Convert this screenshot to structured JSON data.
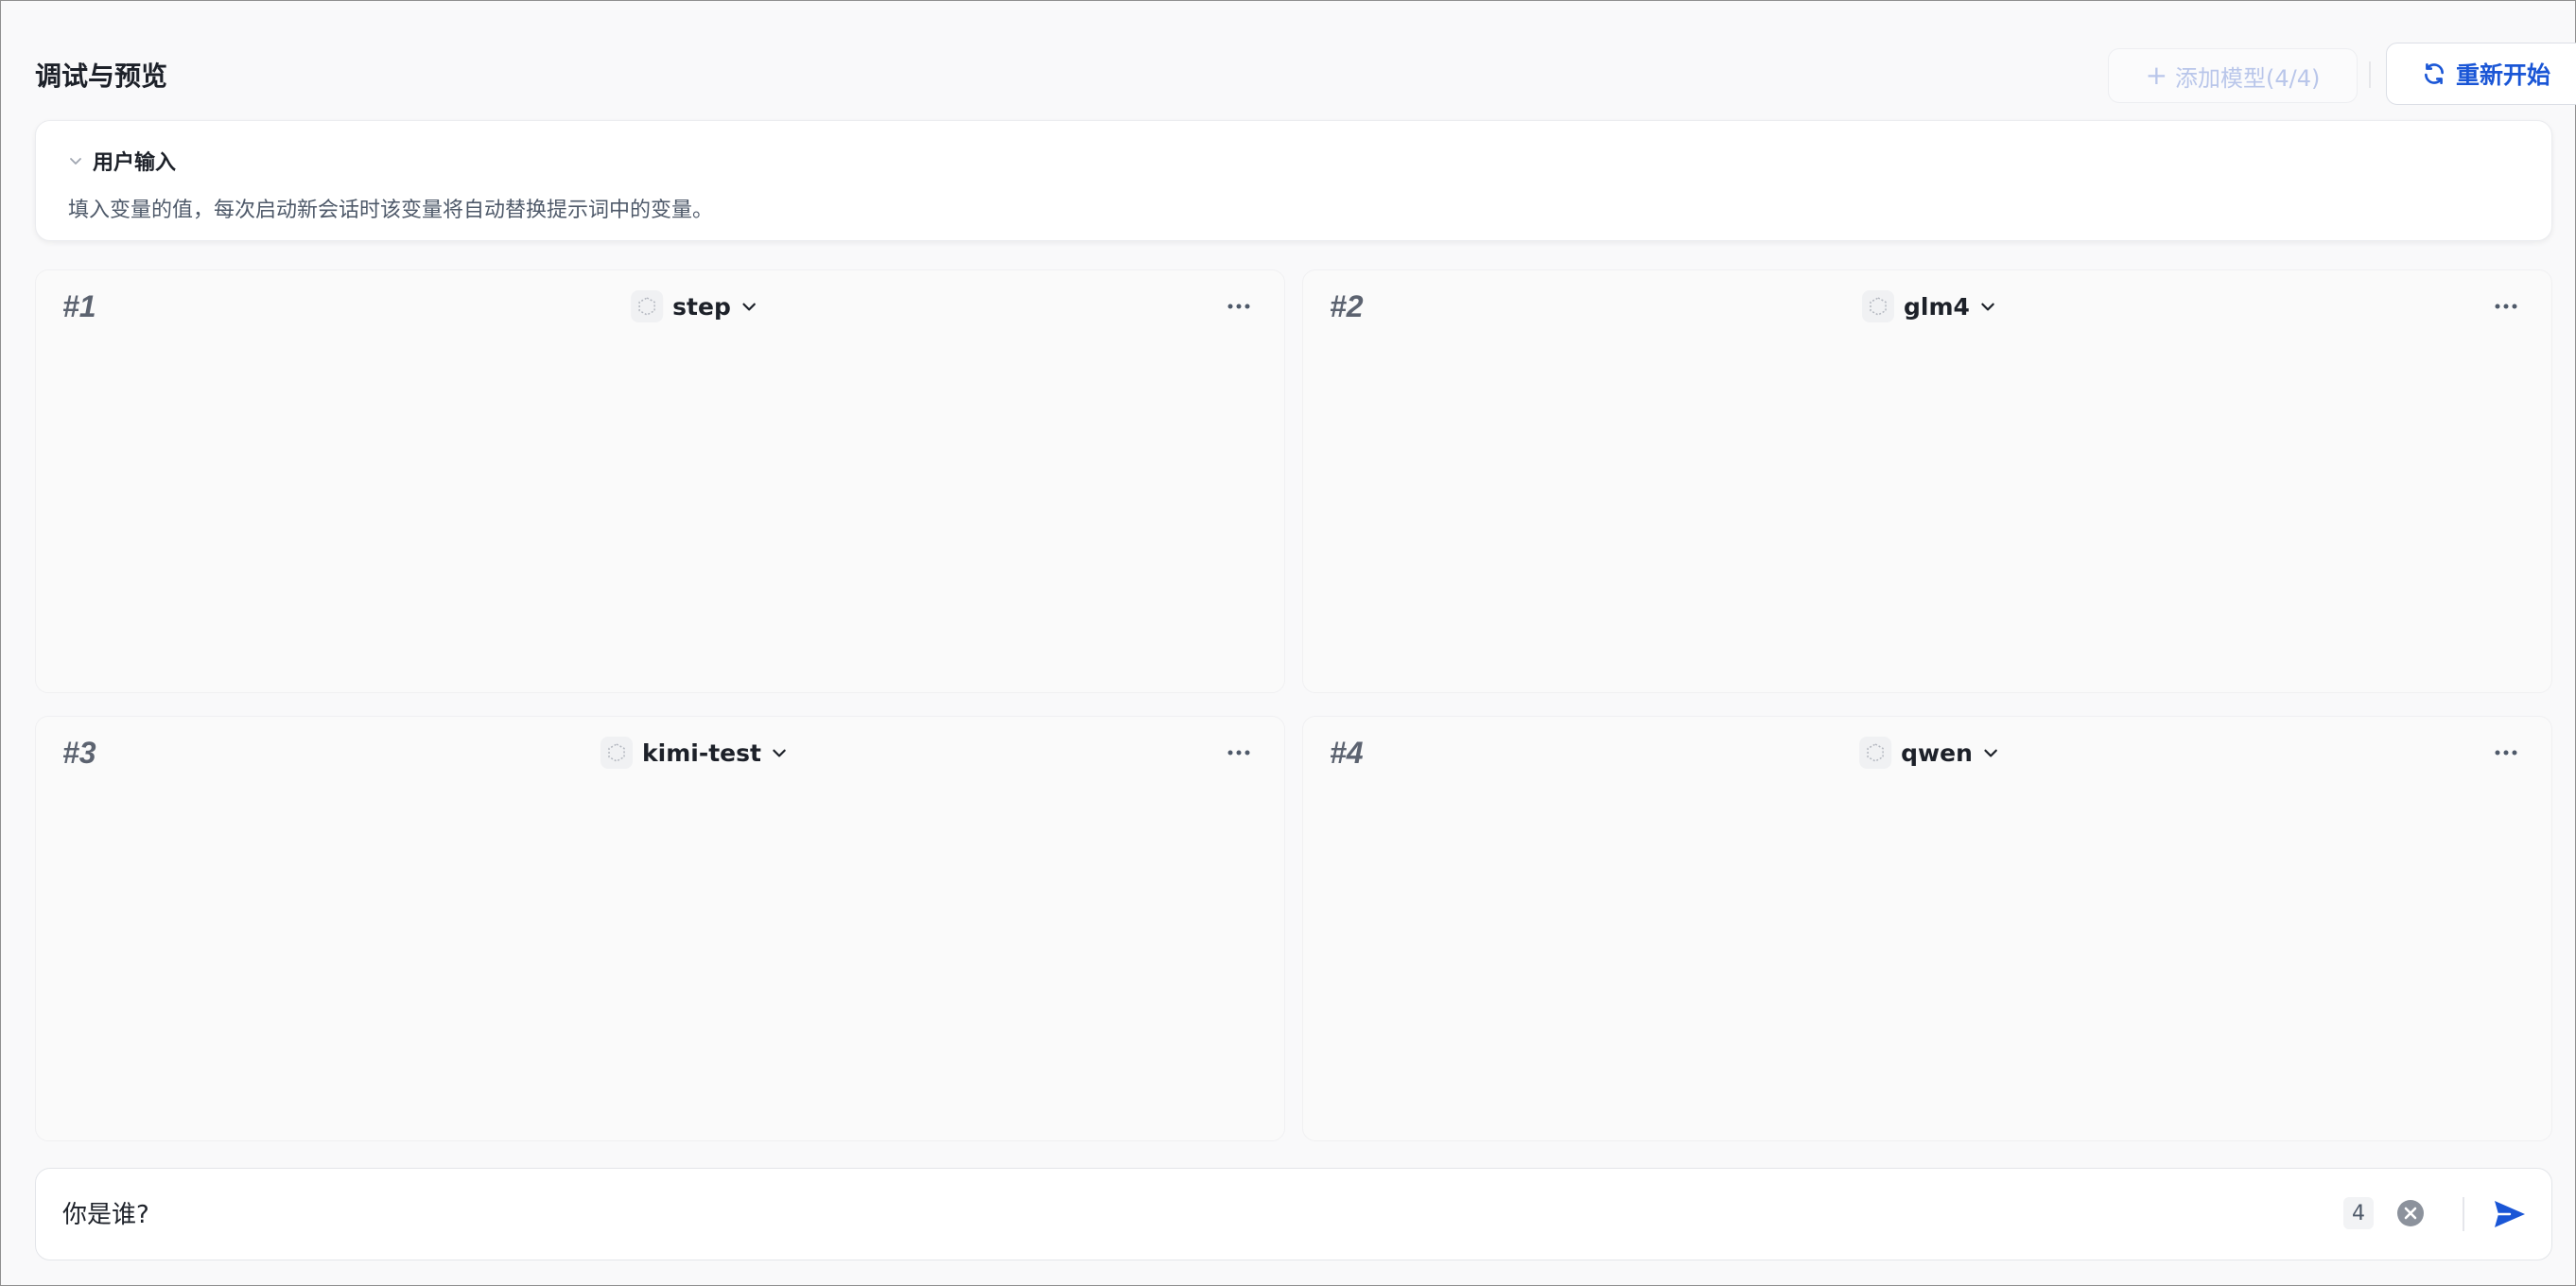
{
  "header": {
    "title": "调试与预览",
    "add_model_label": "添加模型(4/4)",
    "restart_label": "重新开始"
  },
  "user_input": {
    "title": "用户输入",
    "description": "填入变量的值，每次启动新会话时该变量将自动替换提示词中的变量。"
  },
  "panels": [
    {
      "number": "#1",
      "model": "step"
    },
    {
      "number": "#2",
      "model": "glm4"
    },
    {
      "number": "#3",
      "model": "kimi-test"
    },
    {
      "number": "#4",
      "model": "qwen"
    }
  ],
  "chat_input": {
    "value": "你是谁?",
    "count": "4"
  },
  "colors": {
    "accent": "#1a56d6",
    "disabled": "#b9c6ea"
  },
  "icons": {
    "add": "plus-icon",
    "restart": "refresh-icon",
    "collapse": "chevron-down-icon",
    "model": "model-cube-icon",
    "dropdown": "chevron-down-icon",
    "more": "more-horizontal-icon",
    "clear": "clear-circle-icon",
    "send": "send-icon"
  }
}
